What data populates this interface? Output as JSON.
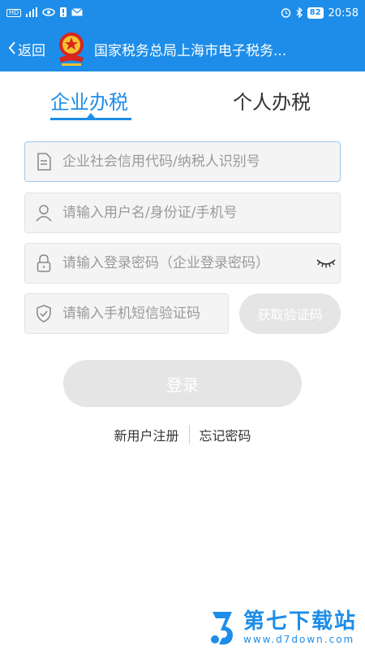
{
  "status_bar": {
    "left_icons": [
      "hd-icon",
      "4g-signal-icon",
      "eye-icon",
      "warning-icon",
      "mail-icon"
    ],
    "right_icons": [
      "alarm-icon",
      "bluetooth-icon"
    ],
    "battery": "82",
    "time": "20:58"
  },
  "nav": {
    "back_label": "返回",
    "title": "国家税务总局上海市电子税务..."
  },
  "tabs": [
    {
      "label": "企业办税",
      "active": true
    },
    {
      "label": "个人办税",
      "active": false
    }
  ],
  "form": {
    "credit_code_placeholder": "企业社会信用代码/纳税人识别号",
    "username_placeholder": "请输入用户名/身份证/手机号",
    "password_placeholder": "请输入登录密码（企业登录密码）",
    "sms_placeholder": "请输入手机短信验证码",
    "get_code_label": "获取验证码",
    "login_label": "登录"
  },
  "links": {
    "register": "新用户注册",
    "forgot": "忘记密码"
  },
  "watermark": {
    "name": "第七下载站",
    "url": "www.d7down.com"
  },
  "colors": {
    "primary": "#1d8de9",
    "disabled_button": "#e5e5e5",
    "field_bg": "#f4f4f4",
    "placeholder": "#9a9a9a"
  }
}
